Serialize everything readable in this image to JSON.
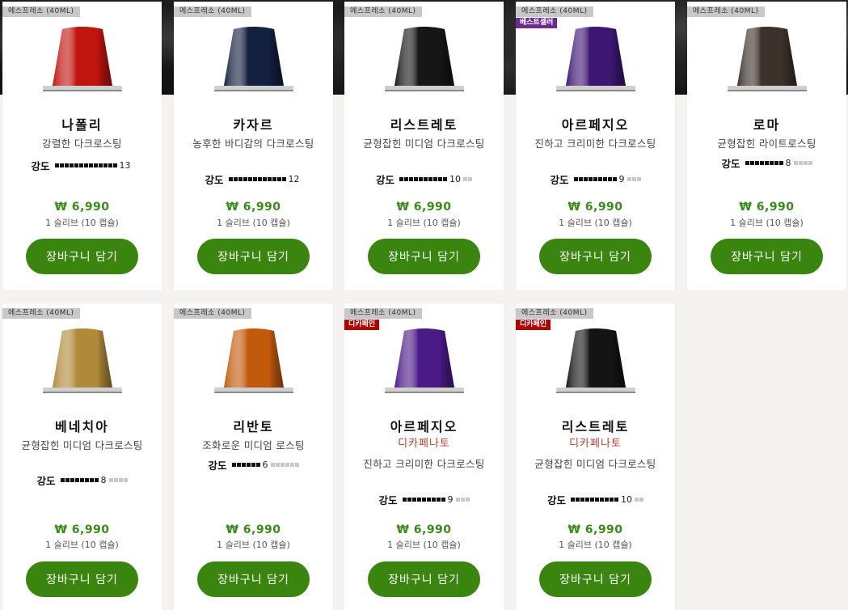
{
  "products": [
    {
      "category": "에스프레소 (40ML)",
      "tag": "",
      "name": "나폴리",
      "sub": "",
      "desc": "강렬한 다크로스팅",
      "intensity_label": "강도",
      "intensity": 13,
      "intensity_max": 13,
      "price": "₩ 6,990",
      "unit": "1 슬리브 (10 캡슐)",
      "button": "장바구니 담기",
      "color": "#c0140e"
    },
    {
      "category": "에스프레소 (40ML)",
      "tag": "",
      "name": "카자르",
      "sub": "",
      "desc": "농후한 바디감의 다크로스팅",
      "intensity_label": "강도",
      "intensity": 12,
      "intensity_max": 12,
      "price": "₩ 6,990",
      "unit": "1 슬리브 (10 캡슐)",
      "button": "장바구니 담기",
      "color": "#14203f"
    },
    {
      "category": "에스프레소 (40ML)",
      "tag": "",
      "name": "리스트레토",
      "sub": "",
      "desc": "균형잡힌 미디엄 다크로스팅",
      "intensity_label": "강도",
      "intensity": 10,
      "intensity_max": 12,
      "price": "₩ 6,990",
      "unit": "1 슬리브 (10 캡슐)",
      "button": "장바구니 담기",
      "color": "#161616"
    },
    {
      "category": "에스프레소 (40ML)",
      "tag": "베스트셀러",
      "name": "아르페지오",
      "sub": "",
      "desc": "진하고 크리미한 다크로스팅",
      "intensity_label": "강도",
      "intensity": 9,
      "intensity_max": 12,
      "price": "₩ 6,990",
      "unit": "1 슬리브 (10 캡슐)",
      "button": "장바구니 담기",
      "color": "#3d1672"
    },
    {
      "category": "에스프레소 (40ML)",
      "tag": "",
      "name": "로마",
      "sub": "",
      "desc": "균형잡힌 라이트로스팅",
      "intensity_label": "강도",
      "intensity": 8,
      "intensity_max": 12,
      "price": "₩ 6,990",
      "unit": "1 슬리브 (10 캡슐)",
      "button": "장바구니 담기",
      "color": "#3c322c"
    },
    {
      "category": "에스프레소 (40ML)",
      "tag": "",
      "name": "베네치아",
      "sub": "",
      "desc": "균형잡힌 미디엄 다크로스팅",
      "intensity_label": "강도",
      "intensity": 8,
      "intensity_max": 12,
      "price": "₩ 6,990",
      "unit": "1 슬리브 (10 캡슐)",
      "button": "장바구니 담기",
      "color": "#b08a3a"
    },
    {
      "category": "에스프레소 (40ML)",
      "tag": "",
      "name": "리반토",
      "sub": "",
      "desc": "조화로운 미디엄 로스팅",
      "intensity_label": "강도",
      "intensity": 6,
      "intensity_max": 12,
      "price": "₩ 6,990",
      "unit": "1 슬리브 (10 캡슐)",
      "button": "장바구니 담기",
      "color": "#c25a0c"
    },
    {
      "category": "에스프레소 (40ML)",
      "tag": "디카페인",
      "name": "아르페지오",
      "sub": "디카페나토",
      "desc": "진하고 크리미한 다크로스팅",
      "intensity_label": "강도",
      "intensity": 9,
      "intensity_max": 12,
      "price": "₩ 6,990",
      "unit": "1 슬리브 (10 캡슐)",
      "button": "장바구니 담기",
      "color": "#4a1a86"
    },
    {
      "category": "에스프레소 (40ML)",
      "tag": "디카페인",
      "name": "리스트레토",
      "sub": "디카페나토",
      "desc": "균형잡힌 미디엄 다크로스팅",
      "intensity_label": "강도",
      "intensity": 10,
      "intensity_max": 12,
      "price": "₩ 6,990",
      "unit": "1 슬리브 (10 캡슐)",
      "button": "장바구니 담기",
      "color": "#141414"
    }
  ],
  "colors": {
    "accent": "#3a850f",
    "price": "#3b8a1b",
    "decaf_tag": "#b00000",
    "best_tag": "#6a2c91",
    "decaf_text": "#c0392b"
  }
}
